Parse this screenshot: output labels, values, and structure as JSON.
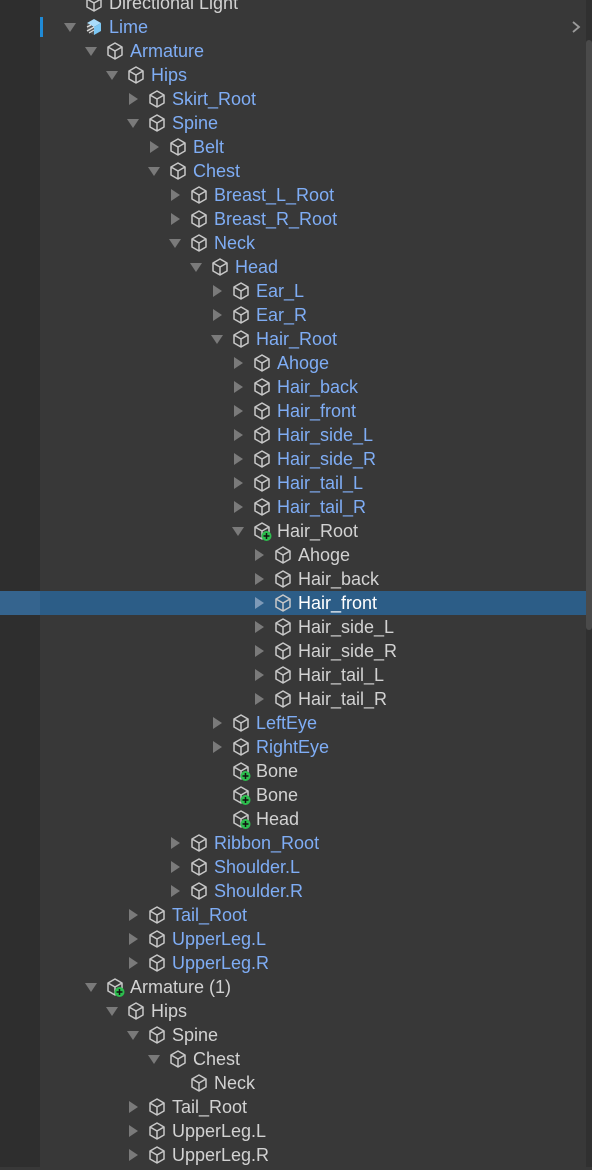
{
  "panel": "hierarchy",
  "colors": {
    "prefab_text": "#7fadf5",
    "normal_text": "#d2d2d2",
    "selection": "#2c5d87",
    "added_badge": "#2dbe4e",
    "prefab_icon": "#7cc8f5"
  },
  "items": [
    {
      "label": "Directional Light",
      "depth": 0,
      "arrow": "none",
      "icon": "cube",
      "prefab": false
    },
    {
      "label": "Lime",
      "depth": 0,
      "arrow": "expanded",
      "icon": "prefab-root",
      "prefab": true
    },
    {
      "label": "Armature",
      "depth": 1,
      "arrow": "expanded",
      "icon": "cube",
      "prefab": true
    },
    {
      "label": "Hips",
      "depth": 2,
      "arrow": "expanded",
      "icon": "cube",
      "prefab": true
    },
    {
      "label": "Skirt_Root",
      "depth": 3,
      "arrow": "collapsed",
      "icon": "cube",
      "prefab": true
    },
    {
      "label": "Spine",
      "depth": 3,
      "arrow": "expanded",
      "icon": "cube",
      "prefab": true
    },
    {
      "label": "Belt",
      "depth": 4,
      "arrow": "collapsed",
      "icon": "cube",
      "prefab": true
    },
    {
      "label": "Chest",
      "depth": 4,
      "arrow": "expanded",
      "icon": "cube",
      "prefab": true
    },
    {
      "label": "Breast_L_Root",
      "depth": 5,
      "arrow": "collapsed",
      "icon": "cube",
      "prefab": true
    },
    {
      "label": "Breast_R_Root",
      "depth": 5,
      "arrow": "collapsed",
      "icon": "cube",
      "prefab": true
    },
    {
      "label": "Neck",
      "depth": 5,
      "arrow": "expanded",
      "icon": "cube",
      "prefab": true
    },
    {
      "label": "Head",
      "depth": 6,
      "arrow": "expanded",
      "icon": "cube",
      "prefab": true
    },
    {
      "label": "Ear_L",
      "depth": 7,
      "arrow": "collapsed",
      "icon": "cube",
      "prefab": true
    },
    {
      "label": "Ear_R",
      "depth": 7,
      "arrow": "collapsed",
      "icon": "cube",
      "prefab": true
    },
    {
      "label": "Hair_Root",
      "depth": 7,
      "arrow": "expanded",
      "icon": "cube",
      "prefab": true
    },
    {
      "label": "Ahoge",
      "depth": 8,
      "arrow": "collapsed",
      "icon": "cube",
      "prefab": true
    },
    {
      "label": "Hair_back",
      "depth": 8,
      "arrow": "collapsed",
      "icon": "cube",
      "prefab": true
    },
    {
      "label": "Hair_front",
      "depth": 8,
      "arrow": "collapsed",
      "icon": "cube",
      "prefab": true
    },
    {
      "label": "Hair_side_L",
      "depth": 8,
      "arrow": "collapsed",
      "icon": "cube",
      "prefab": true
    },
    {
      "label": "Hair_side_R",
      "depth": 8,
      "arrow": "collapsed",
      "icon": "cube",
      "prefab": true
    },
    {
      "label": "Hair_tail_L",
      "depth": 8,
      "arrow": "collapsed",
      "icon": "cube",
      "prefab": true
    },
    {
      "label": "Hair_tail_R",
      "depth": 8,
      "arrow": "collapsed",
      "icon": "cube",
      "prefab": true
    },
    {
      "label": "Hair_Root",
      "depth": 8,
      "arrow": "expanded",
      "icon": "cube-added",
      "prefab": false
    },
    {
      "label": "Ahoge",
      "depth": 9,
      "arrow": "collapsed",
      "icon": "cube",
      "prefab": false
    },
    {
      "label": "Hair_back",
      "depth": 9,
      "arrow": "collapsed",
      "icon": "cube",
      "prefab": false
    },
    {
      "label": "Hair_front",
      "depth": 9,
      "arrow": "collapsed",
      "icon": "cube",
      "prefab": false,
      "selected": true
    },
    {
      "label": "Hair_side_L",
      "depth": 9,
      "arrow": "collapsed",
      "icon": "cube",
      "prefab": false
    },
    {
      "label": "Hair_side_R",
      "depth": 9,
      "arrow": "collapsed",
      "icon": "cube",
      "prefab": false
    },
    {
      "label": "Hair_tail_L",
      "depth": 9,
      "arrow": "collapsed",
      "icon": "cube",
      "prefab": false
    },
    {
      "label": "Hair_tail_R",
      "depth": 9,
      "arrow": "collapsed",
      "icon": "cube",
      "prefab": false
    },
    {
      "label": "LeftEye",
      "depth": 7,
      "arrow": "collapsed",
      "icon": "cube",
      "prefab": true
    },
    {
      "label": "RightEye",
      "depth": 7,
      "arrow": "collapsed",
      "icon": "cube",
      "prefab": true
    },
    {
      "label": "Bone",
      "depth": 7,
      "arrow": "none",
      "icon": "cube-added",
      "prefab": false
    },
    {
      "label": "Bone",
      "depth": 7,
      "arrow": "none",
      "icon": "cube-added",
      "prefab": false
    },
    {
      "label": "Head",
      "depth": 7,
      "arrow": "none",
      "icon": "cube-added",
      "prefab": false
    },
    {
      "label": "Ribbon_Root",
      "depth": 5,
      "arrow": "collapsed",
      "icon": "cube",
      "prefab": true
    },
    {
      "label": "Shoulder.L",
      "depth": 5,
      "arrow": "collapsed",
      "icon": "cube",
      "prefab": true
    },
    {
      "label": "Shoulder.R",
      "depth": 5,
      "arrow": "collapsed",
      "icon": "cube",
      "prefab": true
    },
    {
      "label": "Tail_Root",
      "depth": 3,
      "arrow": "collapsed",
      "icon": "cube",
      "prefab": true
    },
    {
      "label": "UpperLeg.L",
      "depth": 3,
      "arrow": "collapsed",
      "icon": "cube",
      "prefab": true
    },
    {
      "label": "UpperLeg.R",
      "depth": 3,
      "arrow": "collapsed",
      "icon": "cube",
      "prefab": true
    },
    {
      "label": "Armature (1)",
      "depth": 1,
      "arrow": "expanded",
      "icon": "cube-added",
      "prefab": false
    },
    {
      "label": "Hips",
      "depth": 2,
      "arrow": "expanded",
      "icon": "cube",
      "prefab": false
    },
    {
      "label": "Spine",
      "depth": 3,
      "arrow": "expanded",
      "icon": "cube",
      "prefab": false
    },
    {
      "label": "Chest",
      "depth": 4,
      "arrow": "expanded",
      "icon": "cube",
      "prefab": false
    },
    {
      "label": "Neck",
      "depth": 5,
      "arrow": "none",
      "icon": "cube",
      "prefab": false
    },
    {
      "label": "Tail_Root",
      "depth": 3,
      "arrow": "collapsed",
      "icon": "cube",
      "prefab": false
    },
    {
      "label": "UpperLeg.L",
      "depth": 3,
      "arrow": "collapsed",
      "icon": "cube",
      "prefab": false
    },
    {
      "label": "UpperLeg.R",
      "depth": 3,
      "arrow": "collapsed",
      "icon": "cube",
      "prefab": false
    }
  ]
}
